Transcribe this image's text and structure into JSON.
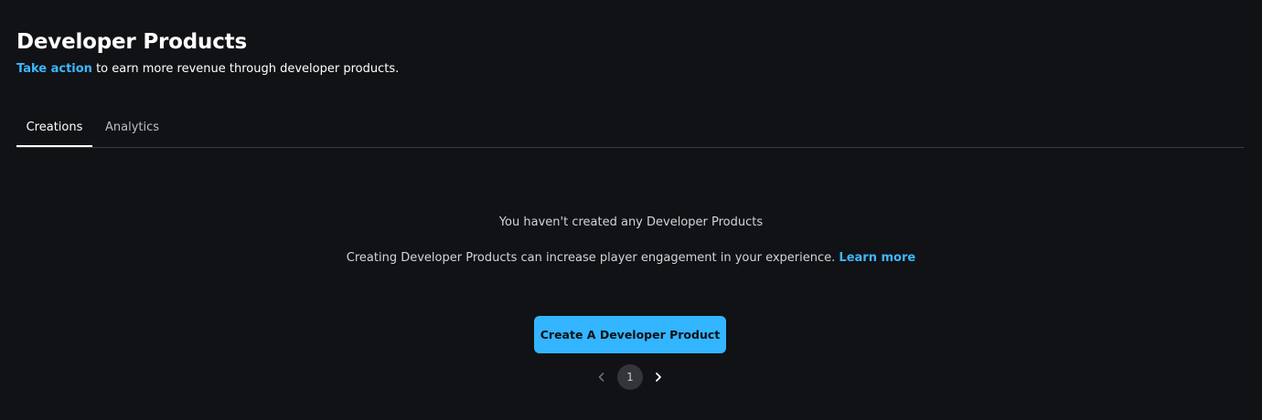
{
  "header": {
    "title": "Developer Products",
    "subtitle_link": "Take action",
    "subtitle_rest": " to earn more revenue through developer products."
  },
  "tabs": [
    {
      "label": "Creations",
      "active": true
    },
    {
      "label": "Analytics",
      "active": false
    }
  ],
  "empty_state": {
    "title": "You haven't created any Developer Products",
    "description": "Creating Developer Products can increase player engagement in your experience. ",
    "learn_more": "Learn more",
    "create_button": "Create A Developer Product"
  },
  "pagination": {
    "current_page": "1",
    "prev_icon": "chevron-left-icon",
    "next_icon": "chevron-right-icon"
  },
  "colors": {
    "background": "#111216",
    "link": "#3fb6ff",
    "primary_button": "#33b5ff",
    "divider": "#393b40"
  }
}
